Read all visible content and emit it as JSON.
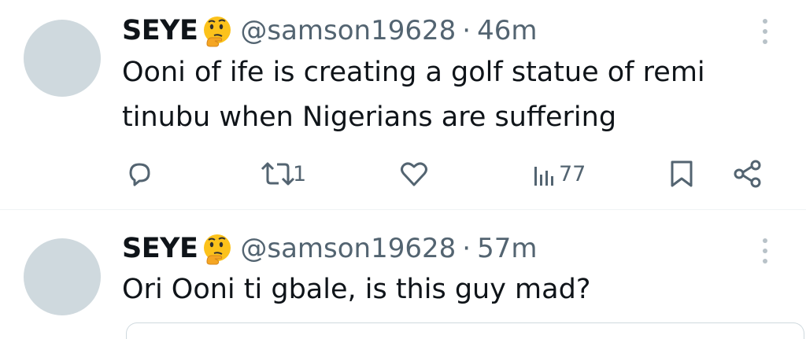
{
  "tweets": [
    {
      "name": "SEYE",
      "handle": "@samson19628",
      "separator": "·",
      "time": "46m",
      "text_line1": "Ooni of ife is creating a golf statue of remi",
      "text_line2": "tinubu when Nigerians are suffering",
      "retweets": "1",
      "views": "77"
    },
    {
      "name": "SEYE",
      "handle": "@samson19628",
      "separator": "·",
      "time": "57m",
      "text_line1": "Ori Ooni ti gbale, is this guy mad?"
    }
  ],
  "icons": {
    "name_emoji": "thinking-face-emoji",
    "reply": "reply-icon",
    "retweet": "retweet-icon",
    "like": "heart-icon",
    "views": "analytics-icon",
    "bookmark": "bookmark-icon",
    "share": "share-icon",
    "more": "more-options-icon"
  },
  "colors": {
    "text": "#0f1419",
    "secondary": "#536471",
    "avatar": "#cfd9de",
    "divider": "#eff3f4"
  }
}
